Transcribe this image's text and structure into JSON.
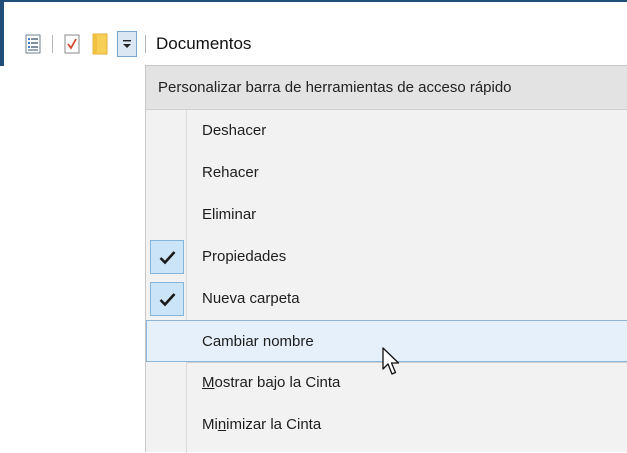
{
  "toolbar": {
    "window_title": "Documentos",
    "buttons": [
      {
        "icon": "properties-icon"
      },
      {
        "icon": "checklist-icon"
      },
      {
        "icon": "folder-icon"
      },
      {
        "icon": "customize-dropdown-icon"
      }
    ]
  },
  "menu": {
    "header": "Personalizar barra de herramientas de acceso rápido",
    "items": [
      {
        "label": "Deshacer",
        "checked": false
      },
      {
        "label": "Rehacer",
        "checked": false
      },
      {
        "label": "Eliminar",
        "checked": false
      },
      {
        "label": "Propiedades",
        "checked": true
      },
      {
        "label": "Nueva carpeta",
        "checked": true
      },
      {
        "label": "Cambiar nombre",
        "checked": false,
        "highlighted": true
      },
      {
        "label_prefix": "",
        "label_underlined": "M",
        "label_rest": "ostrar bajo la Cinta"
      },
      {
        "label_prefix": "Mi",
        "label_underlined": "n",
        "label_rest": "imizar la Cinta"
      }
    ]
  },
  "colors": {
    "accent": "#1f4e79",
    "check_bg": "#cce4f7",
    "check_border": "#84b5dd",
    "highlight_bg": "#e5f0fa",
    "highlight_border": "#8db6dc",
    "menu_bg": "#f2f2f2",
    "header_bg": "#e3e3e3"
  }
}
